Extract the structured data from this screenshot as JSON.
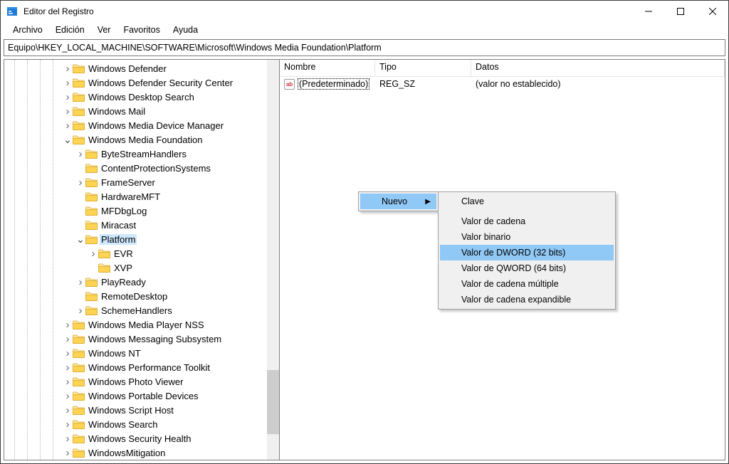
{
  "window": {
    "title": "Editor del Registro"
  },
  "menu": {
    "file": "Archivo",
    "edit": "Edición",
    "view": "Ver",
    "favorites": "Favoritos",
    "help": "Ayuda"
  },
  "address": "Equipo\\HKEY_LOCAL_MACHINE\\SOFTWARE\\Microsoft\\Windows Media Foundation\\Platform",
  "columns": {
    "name": "Nombre",
    "type": "Tipo",
    "data": "Datos"
  },
  "values": [
    {
      "name": "(Predeterminado)",
      "type": "REG_SZ",
      "data": "(valor no establecido)"
    }
  ],
  "tree": {
    "items": [
      {
        "indent": 4,
        "expand": ">",
        "label": "Windows Defender"
      },
      {
        "indent": 4,
        "expand": ">",
        "label": "Windows Defender Security Center"
      },
      {
        "indent": 4,
        "expand": ">",
        "label": "Windows Desktop Search"
      },
      {
        "indent": 4,
        "expand": ">",
        "label": "Windows Mail"
      },
      {
        "indent": 4,
        "expand": ">",
        "label": "Windows Media Device Manager"
      },
      {
        "indent": 4,
        "expand": "v",
        "label": "Windows Media Foundation"
      },
      {
        "indent": 5,
        "expand": ">",
        "label": "ByteStreamHandlers"
      },
      {
        "indent": 5,
        "expand": "",
        "label": "ContentProtectionSystems"
      },
      {
        "indent": 5,
        "expand": ">",
        "label": "FrameServer"
      },
      {
        "indent": 5,
        "expand": "",
        "label": "HardwareMFT"
      },
      {
        "indent": 5,
        "expand": "",
        "label": "MFDbgLog"
      },
      {
        "indent": 5,
        "expand": "",
        "label": "Miracast"
      },
      {
        "indent": 5,
        "expand": "v",
        "label": "Platform",
        "selected": true
      },
      {
        "indent": 6,
        "expand": ">",
        "label": "EVR"
      },
      {
        "indent": 6,
        "expand": "",
        "label": "XVP"
      },
      {
        "indent": 5,
        "expand": ">",
        "label": "PlayReady"
      },
      {
        "indent": 5,
        "expand": "",
        "label": "RemoteDesktop"
      },
      {
        "indent": 5,
        "expand": ">",
        "label": "SchemeHandlers"
      },
      {
        "indent": 4,
        "expand": ">",
        "label": "Windows Media Player NSS"
      },
      {
        "indent": 4,
        "expand": ">",
        "label": "Windows Messaging Subsystem"
      },
      {
        "indent": 4,
        "expand": ">",
        "label": "Windows NT"
      },
      {
        "indent": 4,
        "expand": ">",
        "label": "Windows Performance Toolkit"
      },
      {
        "indent": 4,
        "expand": ">",
        "label": "Windows Photo Viewer"
      },
      {
        "indent": 4,
        "expand": ">",
        "label": "Windows Portable Devices"
      },
      {
        "indent": 4,
        "expand": ">",
        "label": "Windows Script Host"
      },
      {
        "indent": 4,
        "expand": ">",
        "label": "Windows Search"
      },
      {
        "indent": 4,
        "expand": ">",
        "label": "Windows Security Health"
      },
      {
        "indent": 4,
        "expand": ">",
        "label": "WindowsMitigation"
      }
    ]
  },
  "context": {
    "nuevo": "Nuevo",
    "submenu": [
      "Clave",
      "Valor de cadena",
      "Valor binario",
      "Valor de DWORD (32 bits)",
      "Valor de QWORD (64 bits)",
      "Valor de cadena múltiple",
      "Valor de cadena expandible"
    ]
  }
}
